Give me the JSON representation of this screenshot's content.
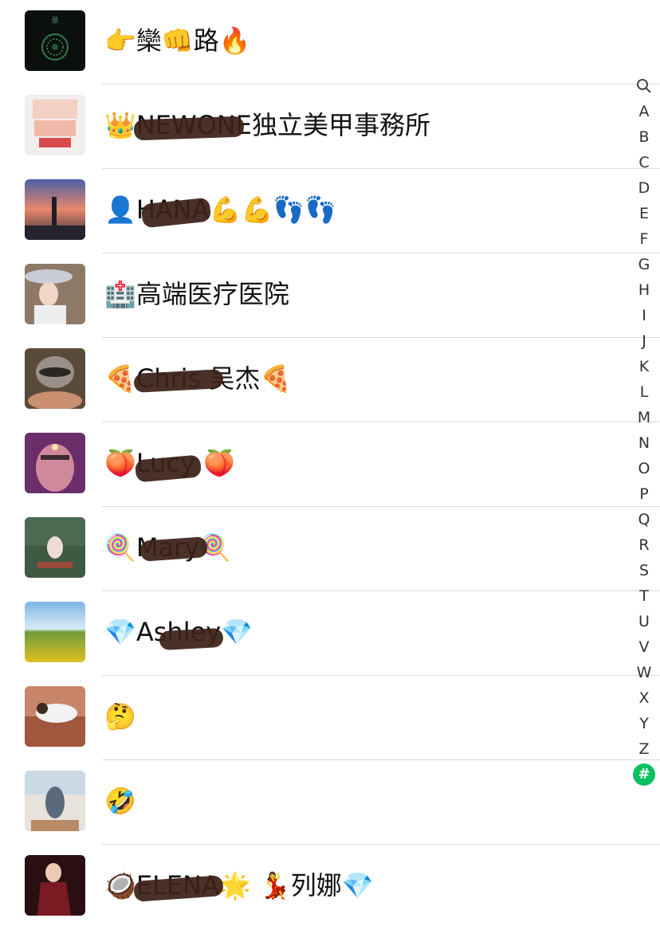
{
  "contacts": [
    {
      "name": "👉欒👊路🔥"
    },
    {
      "name": "👑NEWONE独立美甲事務所"
    },
    {
      "name": "👤HANA💪💪👣👣"
    },
    {
      "name": "🏥高端医疗医院"
    },
    {
      "name": "🍕Chris 吴杰🍕"
    },
    {
      "name": "🍑Lucy 🍑"
    },
    {
      "name": "🍭Mary🍭"
    },
    {
      "name": "💎Ashley💎"
    },
    {
      "name": "🤔"
    },
    {
      "name": "🤣"
    },
    {
      "name": "🥥ELENA🌟 💃列娜💎"
    }
  ],
  "index": {
    "search_icon": "search-icon",
    "letters": [
      "A",
      "B",
      "C",
      "D",
      "E",
      "F",
      "G",
      "H",
      "I",
      "J",
      "K",
      "L",
      "M",
      "N",
      "O",
      "P",
      "Q",
      "R",
      "S",
      "T",
      "U",
      "V",
      "W",
      "X",
      "Y",
      "Z"
    ],
    "hash": "#"
  },
  "colors": {
    "accent": "#07c160",
    "divider": "#dcdcdc"
  }
}
